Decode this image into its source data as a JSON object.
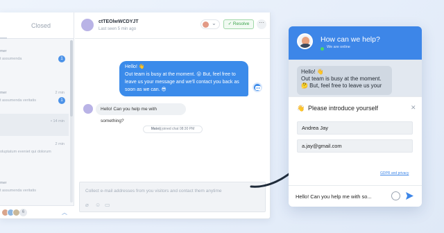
{
  "agent_panel": {
    "tabs": {
      "closed": "Closed"
    },
    "conversations": [
      {
        "name": "mer",
        "text": "t assumenda",
        "time": "",
        "badge": "1"
      },
      {
        "name": "mer",
        "text": "t assumenda veritatis",
        "time": "2 min",
        "badge": "1"
      },
      {
        "name": "",
        "text": "",
        "time": "• 14 min",
        "badge": ""
      },
      {
        "name": "",
        "text": "oluptatum eveniet qui dolorum",
        "time": "2 min",
        "badge": ""
      },
      {
        "name": "mer",
        "text": "t assumenda veritatis",
        "time": "",
        "badge": ""
      }
    ],
    "agents_more": "6"
  },
  "chat": {
    "visitor_name": "ctTEOlwWCDYJT",
    "last_seen": "Last seen 5 min ago",
    "resolve_label": "Resolve",
    "more_label": "···",
    "outgoing_message": "Hello! 👋\nOut team is busy at the moment. 😮 But, feel free to\nleave us your message and we'll contact you back as\nsoon as we can. 😎",
    "incoming_message": "Hello! Can you help me with something?",
    "system_name": "Mateij",
    "system_action": "joined chat",
    "system_time": "08:30 PM",
    "composer_placeholder": "Collect e-mail addresses from you visitors and contact them anytime"
  },
  "widget": {
    "title": "How can we help?",
    "status": "We are online",
    "message": "Hello! 👋\nOut team is busy at the moment.\n🤔 But, feel free to leave us your",
    "card_title": "Please introduce yourself",
    "card_emoji": "👋",
    "close_label": "✕",
    "name_value": "Andrea Jay",
    "email_value": "a.jay@gmail.com",
    "gdpr_link": "GDPR and privacy",
    "input_text": "Hello! Can you help me with so..."
  },
  "colors": {
    "accent": "#3d86e8",
    "resolve": "#3aa34a",
    "online": "#4cd964"
  }
}
